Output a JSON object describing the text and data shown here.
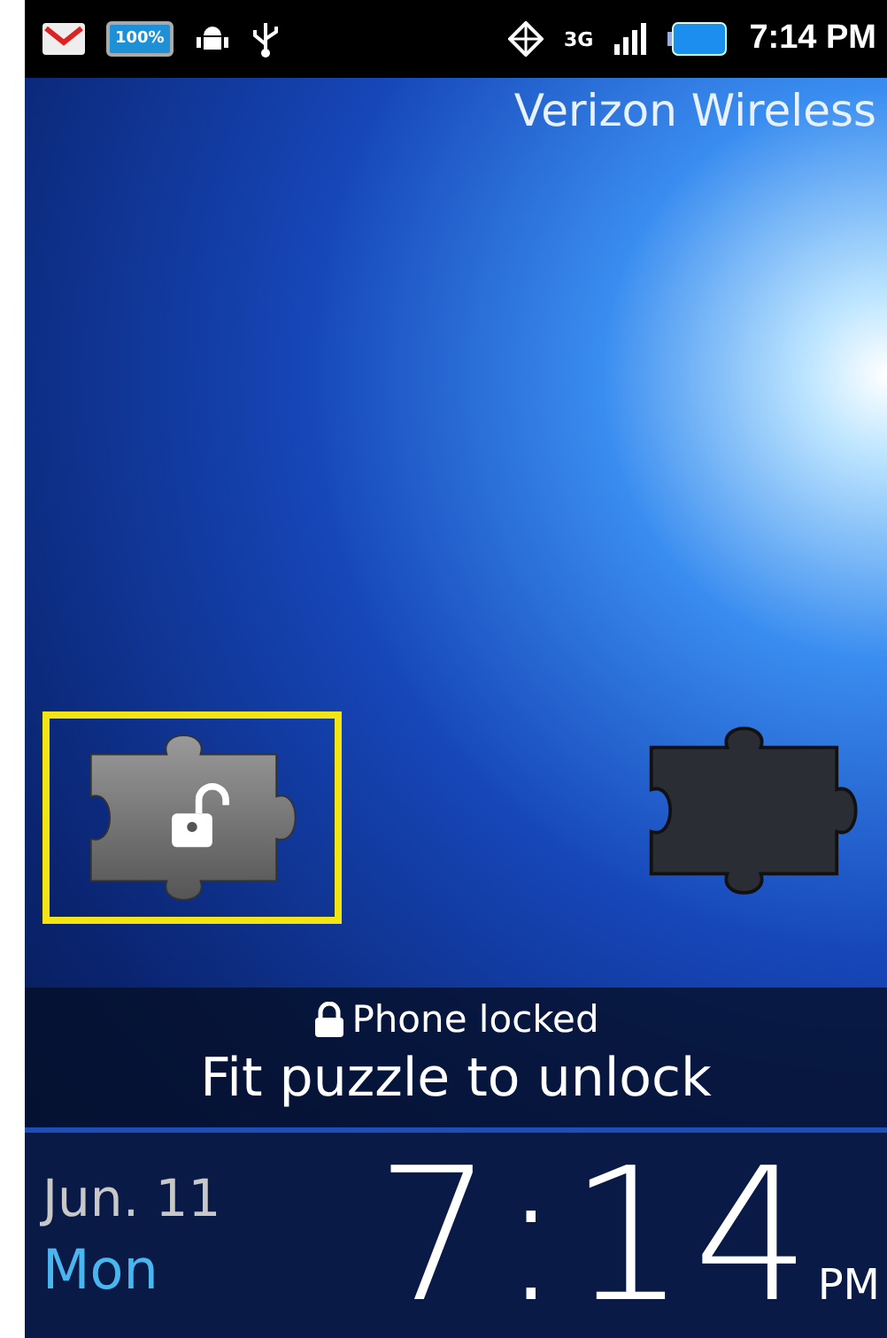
{
  "status_bar": {
    "battery_percent": "100%",
    "network": "3G",
    "time": "7:14 PM"
  },
  "carrier": "Verizon Wireless",
  "lock_banner": {
    "status": "Phone locked",
    "instruction": "Fit puzzle to unlock"
  },
  "clock": {
    "date": "Jun. 11",
    "day": "Mon",
    "time": "7:14",
    "ampm": "PM"
  }
}
